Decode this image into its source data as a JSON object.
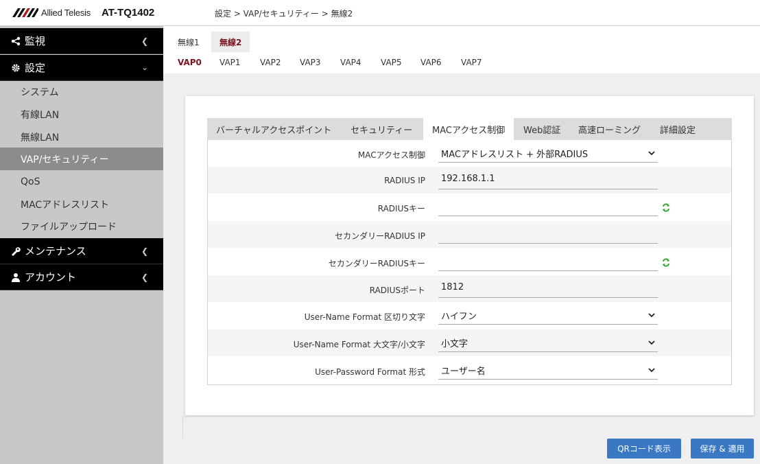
{
  "header": {
    "logo_text": "Allied Telesis",
    "model": "AT-TQ1402",
    "breadcrumb": "設定 > VAP/セキュリティー > 無線2"
  },
  "sidebar": {
    "groups": [
      {
        "label": "監視",
        "icon": "share-icon"
      },
      {
        "label": "設定",
        "icon": "gear-icon"
      },
      {
        "label": "メンテナンス",
        "icon": "wrench-icon"
      },
      {
        "label": "アカウント",
        "icon": "user-icon"
      }
    ],
    "items": [
      {
        "label": "システム"
      },
      {
        "label": "有線LAN"
      },
      {
        "label": "無線LAN"
      },
      {
        "label": "VAP/セキュリティー",
        "active": true
      },
      {
        "label": "QoS"
      },
      {
        "label": "MACアドレスリスト"
      },
      {
        "label": "ファイルアップロード"
      }
    ]
  },
  "radio_tabs": [
    {
      "label": "無線1"
    },
    {
      "label": "無線2",
      "active": true
    }
  ],
  "vap_tabs": [
    {
      "label": "VAP0",
      "active": true
    },
    {
      "label": "VAP1"
    },
    {
      "label": "VAP2"
    },
    {
      "label": "VAP3"
    },
    {
      "label": "VAP4"
    },
    {
      "label": "VAP5"
    },
    {
      "label": "VAP6"
    },
    {
      "label": "VAP7"
    }
  ],
  "inner_tabs": [
    {
      "label": "バーチャルアクセスポイント"
    },
    {
      "label": "セキュリティー"
    },
    {
      "label": "MACアクセス制御",
      "active": true
    },
    {
      "label": "Web認証"
    },
    {
      "label": "高速ローミング"
    },
    {
      "label": "詳細設定"
    }
  ],
  "form": {
    "rows": [
      {
        "label": "MACアクセス制御",
        "value": "MACアドレスリスト + 外部RADIUS",
        "type": "select"
      },
      {
        "label": "RADIUS IP",
        "value": "192.168.1.1",
        "type": "input"
      },
      {
        "label": "RADIUSキー",
        "value": "",
        "type": "input",
        "icon": "refresh-icon"
      },
      {
        "label": "セカンダリーRADIUS IP",
        "value": "",
        "type": "input"
      },
      {
        "label": "セカンダリーRADIUSキー",
        "value": "",
        "type": "input",
        "icon": "refresh-icon"
      },
      {
        "label": "RADIUSポート",
        "value": "1812",
        "type": "input"
      },
      {
        "label": "User-Name Format 区切り文字",
        "value": "ハイフン",
        "type": "select"
      },
      {
        "label": "User-Name Format 大文字/小文字",
        "value": "小文字",
        "type": "select"
      },
      {
        "label": "User-Password Format 形式",
        "value": "ユーザー名",
        "type": "select"
      }
    ]
  },
  "buttons": {
    "qr": "QRコード表示",
    "save": "保存 & 適用"
  },
  "colors": {
    "accent": "#7a1420",
    "button": "#3a78c3",
    "sidebar_dark": "#000000",
    "sidebar_active": "#8c8c8c",
    "refresh_icon": "#3aa83a"
  }
}
